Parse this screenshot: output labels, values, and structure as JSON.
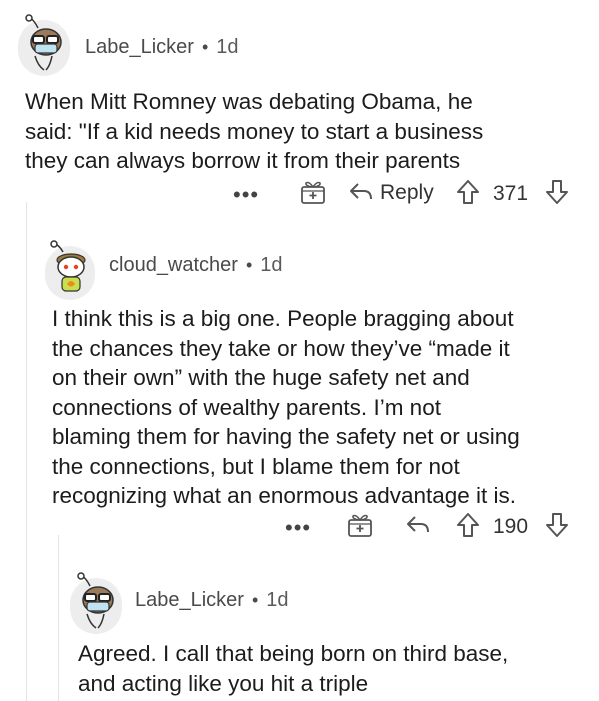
{
  "comments": [
    {
      "username": "Labe_Licker",
      "separator": "•",
      "age": "1d",
      "lines": [
        "When Mitt Romney was debating Obama,  he",
        "said: \"If a kid needs money to start a business",
        "they can always borrow it from their parents"
      ],
      "more": "•••",
      "reply_label": "Reply",
      "votes": "371"
    },
    {
      "username": "cloud_watcher",
      "separator": "•",
      "age": "1d",
      "lines": [
        "I think this is a big one. People bragging about",
        "the chances they take or how they’ve “made it",
        "on their own” with the huge safety net and",
        "connections of wealthy parents. I’m not",
        "blaming them for having the safety net or using",
        "the connections, but I blame them for not",
        "recognizing what an enormous advantage it is."
      ],
      "more": "•••",
      "votes": "190"
    },
    {
      "username": "Labe_Licker",
      "separator": "•",
      "age": "1d",
      "lines": [
        "Agreed.  I call that being born on third base,",
        "and acting like you hit a triple"
      ]
    }
  ],
  "icons": {
    "avatar": "snoo-avatar-icon",
    "award": "award-gift-icon",
    "reply": "reply-arrow-icon",
    "upvote": "upvote-arrow-icon",
    "downvote": "downvote-arrow-icon"
  },
  "colors": {
    "text": "#1c1c1c",
    "meta": "#4a4a4a",
    "thread_line": "#e3e3e3",
    "icon": "#555555"
  }
}
